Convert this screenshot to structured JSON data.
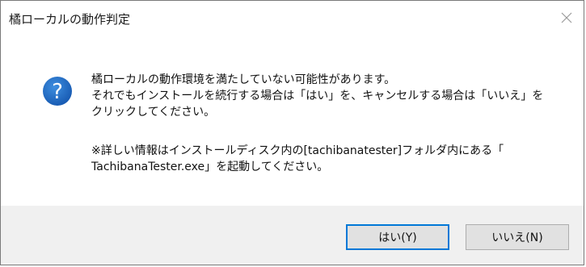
{
  "window": {
    "title": "橘ローカルの動作判定"
  },
  "message": {
    "line1": "橘ローカルの動作環境を満たしていない可能性があります。",
    "line2": "それでもインストールを続行する場合は「はい」を、キャンセルする場合は「いいえ」を",
    "line3": "クリックしてください。",
    "note_line1": "※詳しい情報はインストールディスク内の[tachibanatester]フォルダ内にある「",
    "note_line2": "TachibanaTester.exe」を起動してください。"
  },
  "buttons": {
    "yes_label": "はい(Y)",
    "no_label": "いいえ(N)"
  },
  "icons": {
    "dialog_icon": "question-icon",
    "close_icon": "close-icon"
  },
  "colors": {
    "accent": "#0078d7",
    "question_icon": "#1e6bc1",
    "footer_bg": "#f0f0f0",
    "button_bg": "#e1e1e1"
  }
}
